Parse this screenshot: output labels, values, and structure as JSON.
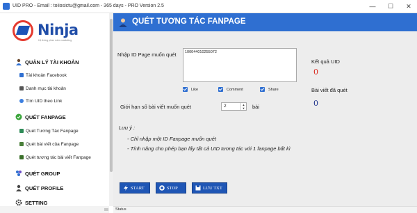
{
  "window": {
    "title": "UID PRO - Email : toiiosictu@gmail.com - 365 days - PRO Version 2.5",
    "minimize": "—",
    "maximize": "☐",
    "close": "✕"
  },
  "logo": {
    "text": "Ninja",
    "tagline": "Hệ thống phần mềm marketing"
  },
  "sidebar": {
    "sections": [
      {
        "label": "QUẢN LÝ TÀI KHOẢN",
        "items": [
          "Tài khoản Facebook",
          "Danh mục tài khoản",
          "Tìm UID theo Link"
        ]
      },
      {
        "label": "QUÉT FANPAGE",
        "items": [
          "Quét Tương Tác Fanpage",
          "Quét bài viết của Fanpage",
          "Quét tương tác bài viết Fanpage"
        ]
      },
      {
        "label": "QUÉT GROUP",
        "items": []
      },
      {
        "label": "QUÉT PROFILE",
        "items": []
      },
      {
        "label": "SETTING",
        "items": []
      }
    ]
  },
  "main": {
    "title": "QUÉT TƯƠNG TÁC FANPAGE",
    "input_label": "Nhập ID Page muốn quét",
    "input_value": "100044010255072",
    "checkboxes": [
      {
        "label": "Like",
        "checked": true
      },
      {
        "label": "Comment",
        "checked": true
      },
      {
        "label": "Share",
        "checked": true
      }
    ],
    "limit_label": "Giới hạn số bài viết muốn quét",
    "limit_value": "2",
    "limit_suffix": "bài",
    "result_uid_label": "Kết quả UID",
    "result_uid_value": "0",
    "result_posts_label": "Bài viết đã quét",
    "result_posts_value": "0",
    "note_title": "Lưu ý :",
    "notes": [
      "- Chỉ nhập một ID Fanpage muốn quét",
      "- Tính năng cho phép bạn lấy tất cả UID tương tác với 1 fanpage bất kì"
    ],
    "buttons": {
      "start": "START",
      "stop": "STOP",
      "save": "LƯU TXT"
    }
  },
  "status": "Status",
  "colors": {
    "accent": "#2f6fd1",
    "result_uid": "#d9261c",
    "result_posts": "#1b2f8a"
  }
}
